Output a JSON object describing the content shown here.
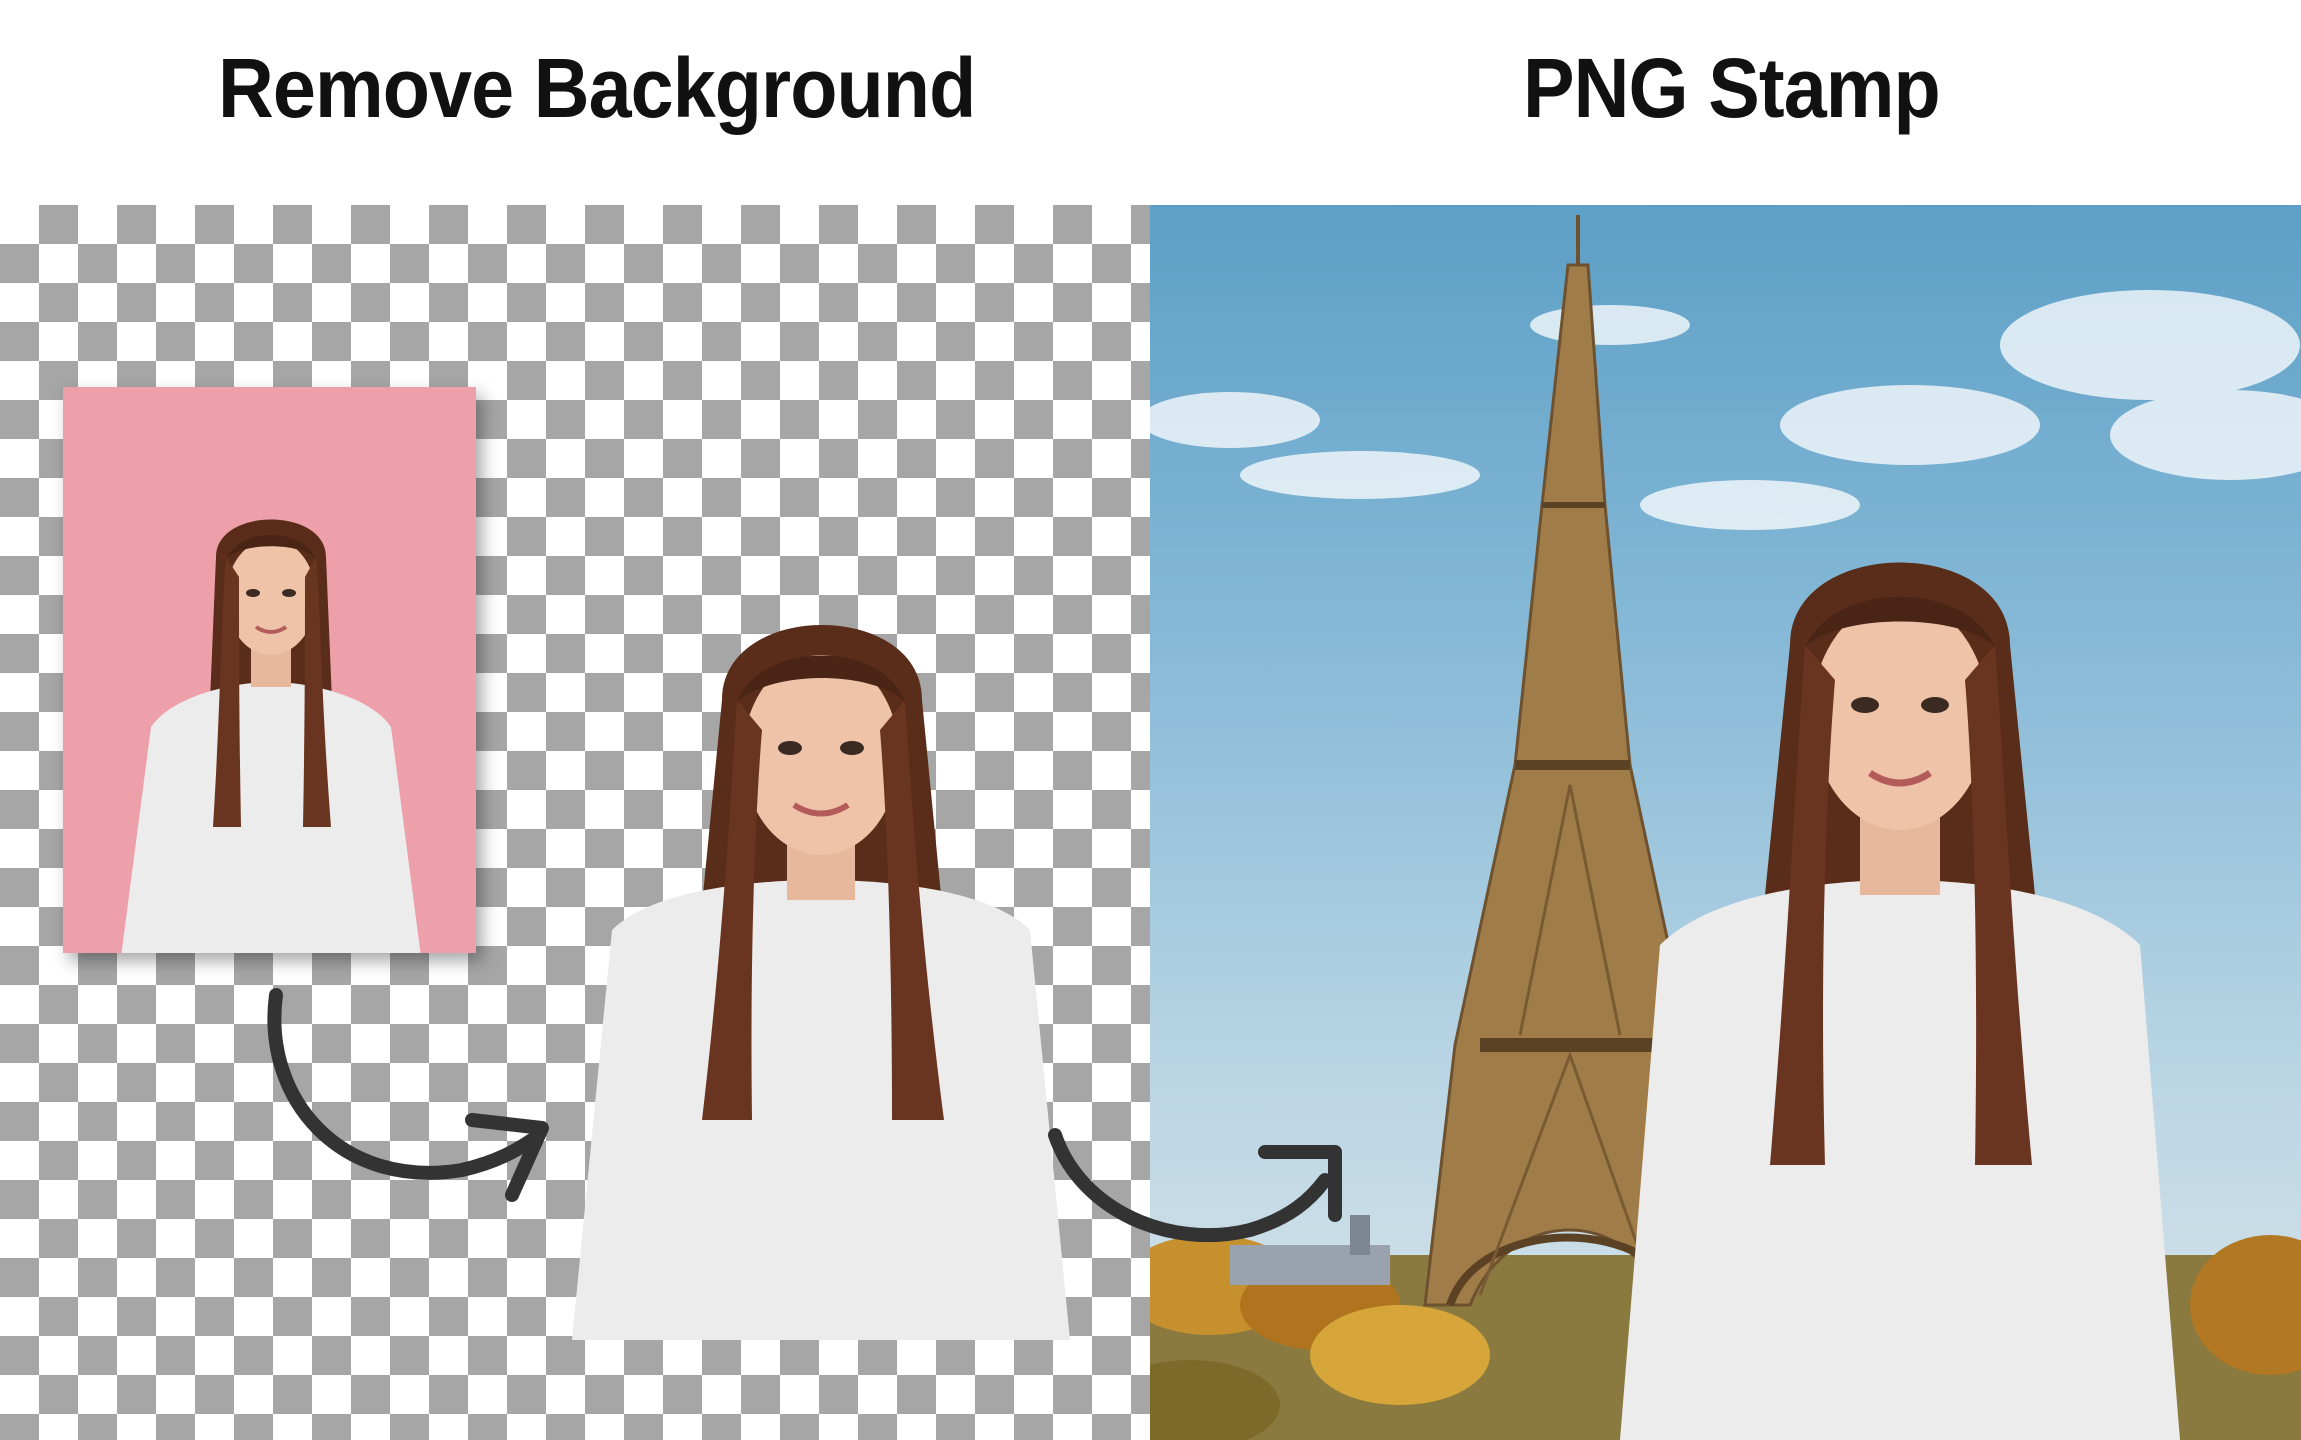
{
  "headings": {
    "left": "Remove Background",
    "right": "PNG Stamp"
  },
  "colors": {
    "checker_dark": "#a6a6a6",
    "checker_light": "#ffffff",
    "original_background": "#eda0aa",
    "sky": "#86b9d7",
    "hair": "#5a2d1a",
    "sweater": "#ececec",
    "tower": "#8a6a3c",
    "arrow": "#333333"
  },
  "images": {
    "original_photo": "woman-on-pink-background-photo",
    "cutout_photo": "woman-cutout-transparent-png",
    "composite_photo": "woman-in-front-of-eiffel-tower",
    "scene": "eiffel-tower-paris-sky-scene"
  },
  "icons": {
    "arrow_1": "curved-arrow-icon",
    "arrow_2": "curved-arrow-icon"
  }
}
